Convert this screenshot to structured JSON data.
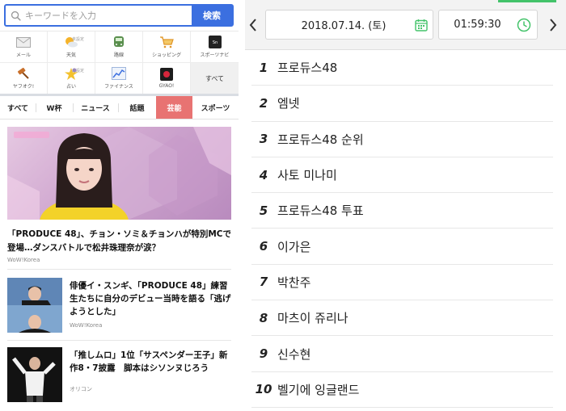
{
  "search": {
    "placeholder": "キーワードを入力",
    "button": "検索"
  },
  "services": [
    {
      "label": "メール",
      "icon": "mail-icon"
    },
    {
      "label": "天気",
      "icon": "weather-icon",
      "badge": "未設定"
    },
    {
      "label": "路線",
      "icon": "train-icon"
    },
    {
      "label": "ショッピング",
      "icon": "cart-icon"
    },
    {
      "label": "スポーツナビ",
      "icon": "sportsnavi-icon"
    },
    {
      "label": "ヤフオク!",
      "icon": "auction-icon"
    },
    {
      "label": "占い",
      "icon": "fortune-icon",
      "badge": "未設定"
    },
    {
      "label": "ファイナンス",
      "icon": "finance-icon"
    },
    {
      "label": "GYAO!",
      "icon": "gyao-icon"
    },
    {
      "label": "すべて",
      "icon": ""
    }
  ],
  "tabs": [
    {
      "label": "すべて"
    },
    {
      "label": "W杯"
    },
    {
      "label": "ニュース"
    },
    {
      "label": "話題"
    },
    {
      "label": "芸能",
      "active": true
    },
    {
      "label": "スポーツ"
    }
  ],
  "news": [
    {
      "title": "「PRODUCE 48」、チョン・ソミ＆チョンハが特別MCで登場…ダンスバトルで松井珠理奈が涙？",
      "source": "WoW!Korea"
    },
    {
      "title": "俳優イ・スンギ、「PRODUCE 48」練習生たちに自分のデビュー当時を語る「逃げようとした」",
      "source": "WoW!Korea"
    },
    {
      "title": "「推しムロ」1位「サスペンダー王子」新作8・7披露　脚本はシソンヌじろう",
      "source": "オリコン"
    }
  ],
  "ranking": {
    "date": "2018.07.14. (토)",
    "time": "01:59:30",
    "items": [
      {
        "rank": "1",
        "term": "프로듀스48"
      },
      {
        "rank": "2",
        "term": "엠넷"
      },
      {
        "rank": "3",
        "term": "프로듀스48 순위"
      },
      {
        "rank": "4",
        "term": "사토 미나미"
      },
      {
        "rank": "5",
        "term": "프로듀스48 투표"
      },
      {
        "rank": "6",
        "term": "이가은"
      },
      {
        "rank": "7",
        "term": "박찬주"
      },
      {
        "rank": "8",
        "term": "마츠이 쥬리나"
      },
      {
        "rank": "9",
        "term": "신수현"
      },
      {
        "rank": "10",
        "term": "벨기에 잉글랜드"
      }
    ]
  },
  "colors": {
    "accent_blue": "#3b6fe0",
    "active_tab": "#e87372",
    "green": "#43c36a"
  }
}
